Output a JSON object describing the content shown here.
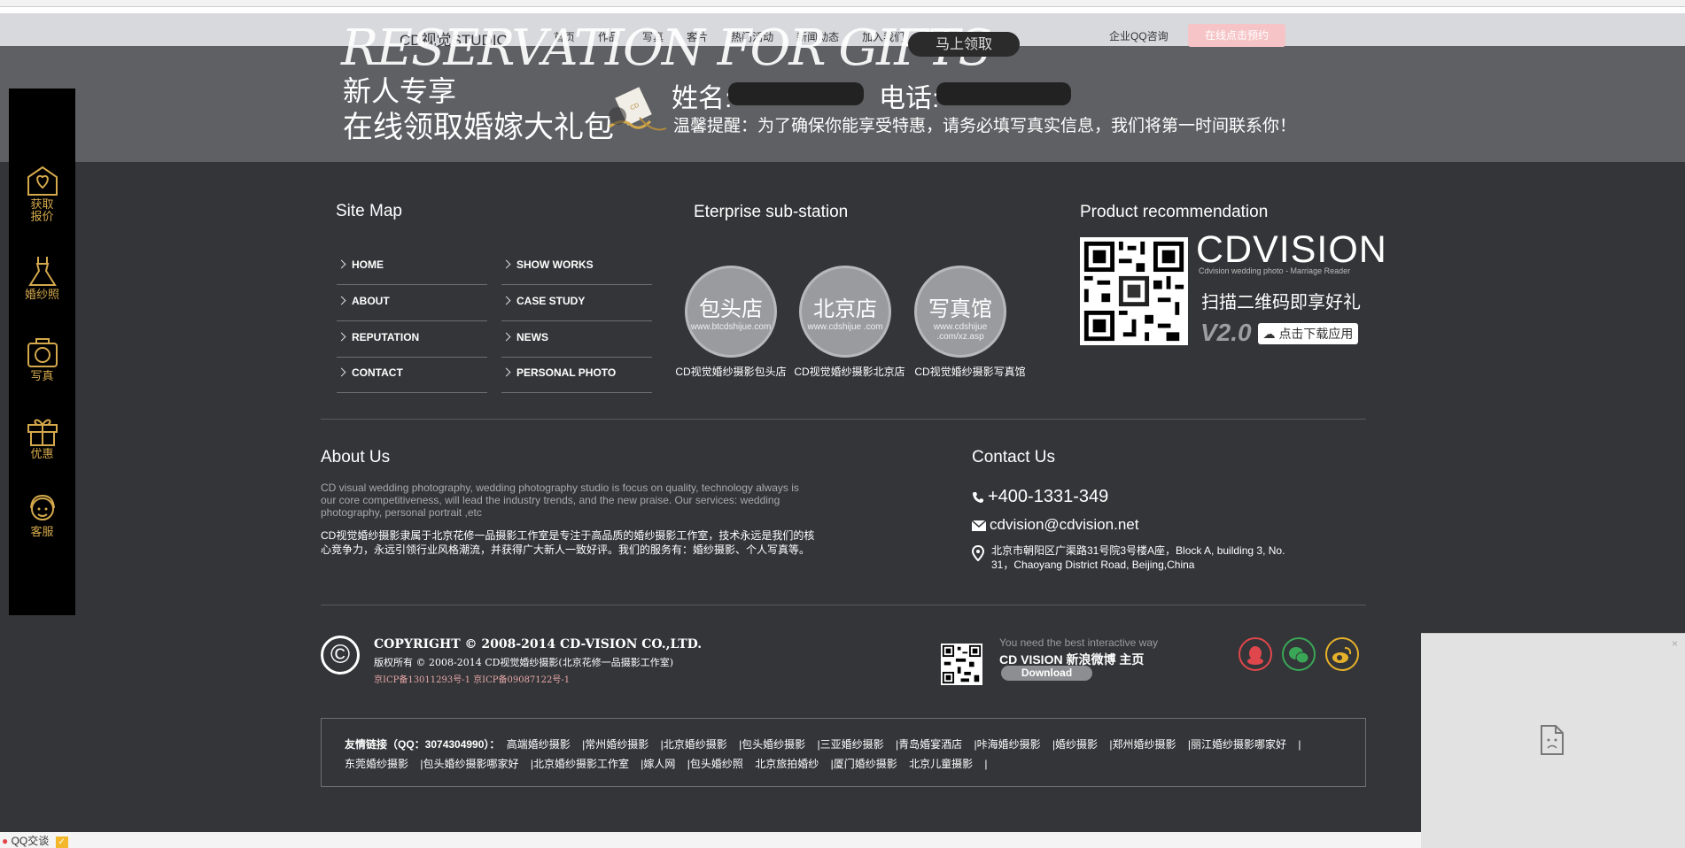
{
  "nav": {
    "brand": "CD视觉STUDIO",
    "items": [
      "首页",
      "作品",
      "写真",
      "客片",
      "热门活动",
      "新闻动态",
      "加入我们"
    ],
    "qq_consult": "企业QQ咨询",
    "book_online": "在线点击预约"
  },
  "promo": {
    "script_title": "RESERVATION FOR GIFTS",
    "claim_button": "马上领取",
    "line1": "新人专享",
    "line2": "在线领取婚嫁大礼包",
    "name_label": "姓名:",
    "phone_label": "电话:",
    "tip": "温馨提醒：为了确保你能享受特惠，请务必填写真实信息，我们将第一时间联系你！"
  },
  "sidebar": {
    "items": [
      {
        "label": "获取\n报价",
        "icon": "heart-envelope-icon"
      },
      {
        "label": "婚纱照",
        "icon": "wedding-dress-icon"
      },
      {
        "label": "写真",
        "icon": "camera-icon"
      },
      {
        "label": "优惠",
        "icon": "gift-icon"
      },
      {
        "label": "客服",
        "icon": "customer-service-icon"
      }
    ]
  },
  "sitemap": {
    "title": "Site Map",
    "col1": [
      "HOME",
      "ABOUT",
      "REPUTATION",
      "CONTACT"
    ],
    "col2": [
      "SHOW WORKS",
      "CASE STUDY",
      "NEWS",
      "PERSONAL PHOTO"
    ]
  },
  "substation": {
    "title": "Eterprise sub-station",
    "stations": [
      {
        "name": "包头店",
        "url": "www.btcdshijue.com",
        "caption": "CD视觉婚纱摄影包头店"
      },
      {
        "name": "北京店",
        "url": "www.cdshijue\n.com",
        "caption": "CD视觉婚纱摄影北京店"
      },
      {
        "name": "写真馆",
        "url": "www.cdshijue\n.com/xz.asp",
        "caption": "CD视觉婚纱摄影写真馆"
      }
    ]
  },
  "product": {
    "title": "Product recommendation",
    "logo": "CDVISION",
    "logo_sub": "Cdvision wedding photo - Marriage Reader",
    "scan": "扫描二维码即享好礼",
    "version": "V2.0",
    "download": "点击下载应用"
  },
  "about": {
    "title": "About Us",
    "en": "CD visual wedding photography, wedding photography studio is focus on quality, technology always is our core competitiveness, will lead the industry trends, and the new praise. Our services: wedding photography, personal portrait ,etc",
    "zh": "CD视觉婚纱摄影隶属于北京花修一品摄影工作室是专注于高品质的婚纱摄影工作室，技术永远是我们的核心竞争力，永远引领行业风格潮流，并获得广大新人一致好评。我们的服务有：婚纱摄影、个人写真等。"
  },
  "contact": {
    "title": "Contact Us",
    "phone": "+400-1331-349",
    "email": "cdvision@cdvision.net",
    "address_line1": "北京市朝阳区广渠路31号院3号楼A座，Block A, building 3, No.",
    "address_line2": "31，Chaoyang District Road, Beijing,China"
  },
  "copyright": {
    "symbol": "©",
    "line1": "COPYRIGHT © 2008-2014 CD-VISION CO.,LTD.",
    "line2": "版权所有 © 2008-2014 CD视觉婚纱摄影(北京花修一品摄影工作室)",
    "line3": "京ICP备13011293号-1 京ICP备09087122号-1"
  },
  "interactive": {
    "line1": "You need the best interactive way",
    "line2": "CD VISION 新浪微博 主页",
    "download": "Download"
  },
  "social": [
    {
      "icon": "qq-icon",
      "color": "#e0474c"
    },
    {
      "icon": "wechat-icon",
      "color": "#3aa757"
    },
    {
      "icon": "weibo-icon",
      "color": "#e6b12a"
    }
  ],
  "links": {
    "label": "友情链接（QQ：3074304990）：",
    "row1": [
      "高端婚纱摄影",
      "|常州婚纱摄影",
      "|北京婚纱摄影",
      "|包头婚纱摄影",
      "|三亚婚纱摄影",
      "|青岛婚宴酒店",
      "|咔海婚纱摄影",
      "|婚纱摄影",
      "|郑州婚纱摄影",
      "|丽江婚纱摄影哪家好",
      "|"
    ],
    "row2": [
      "东莞婚纱摄影",
      "|包头婚纱摄影哪家好",
      "|北京婚纱摄影工作室",
      "|嫁人网",
      "|包头婚纱照",
      "北京旅拍婚纱",
      "|厦门婚纱摄影",
      "北京儿童摄影",
      "|"
    ]
  },
  "qqbar": {
    "label": "QQ交谈"
  }
}
